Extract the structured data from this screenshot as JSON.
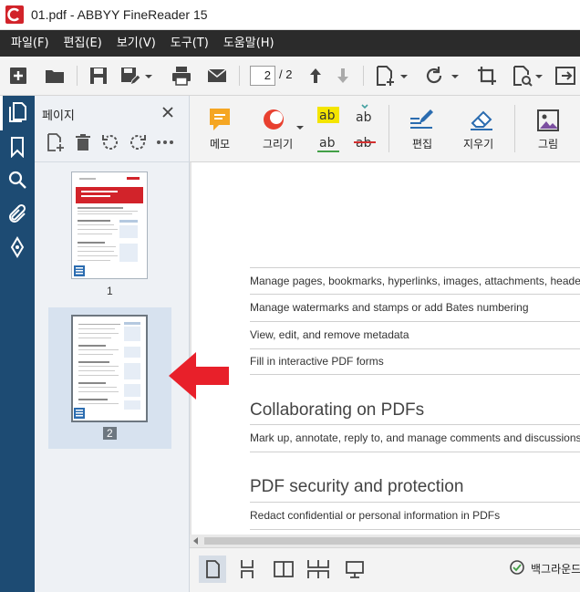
{
  "window": {
    "title": "01.pdf - ABBYY FineReader 15"
  },
  "menu": [
    "파일(F)",
    "편집(E)",
    "보기(V)",
    "도구(T)",
    "도움말(H)"
  ],
  "toolbar": {
    "current_page": "2",
    "page_total": "/ 2",
    "icons": [
      "new-pdf-icon",
      "open-folder-icon",
      "save-icon",
      "save-as-icon",
      "print-icon",
      "email-icon",
      "page-up-icon",
      "page-down-icon",
      "add-page-icon",
      "rotate-icon",
      "crop-icon",
      "search-page-icon",
      "export-icon"
    ]
  },
  "leftnav": {
    "icons": [
      "pages-icon",
      "bookmarks-icon",
      "search-icon",
      "attachments-icon",
      "signatures-icon"
    ]
  },
  "pages_panel": {
    "title": "페이지",
    "tools": [
      "add-page-icon",
      "delete-icon",
      "rotate-left-icon",
      "rotate-right-icon",
      "more-icon"
    ],
    "thumbnails": [
      {
        "number": "1",
        "selected": false
      },
      {
        "number": "2",
        "selected": true
      }
    ]
  },
  "ribbon": {
    "note": "메모",
    "draw": "그리기",
    "edit": "편집",
    "erase": "지우기",
    "image": "그림",
    "text_tools": [
      "highlight-text-icon",
      "insert-text-icon",
      "underline-text-icon",
      "strikethrough-text-icon"
    ],
    "colors": {
      "note": "#f5a623",
      "draw": "#e8402f",
      "highlight": "#f4e500",
      "underline": "#43a047",
      "strike": "#d32f2f",
      "edit": "#2b6cb0"
    }
  },
  "document": {
    "rows": [
      "Manage pages, bookmarks, hyperlinks, images, attachments, headers and footers",
      "Manage watermarks and stamps or add Bates numbering",
      "View, edit, and remove metadata",
      "Fill in interactive PDF forms"
    ],
    "heading_collab": "Collaborating on PDFs",
    "collab_rows": [
      "Mark up, annotate, reply to, and manage comments and discussions in PDFs"
    ],
    "heading_security": "PDF security and protection",
    "security_rows": [
      "Redact confidential or personal information in PDFs"
    ]
  },
  "bottombar": {
    "background_status": "백그라운드",
    "views": [
      "single-page-view-icon",
      "scroll-view-icon",
      "two-page-view-icon",
      "two-page-scroll-view-icon",
      "presentation-view-icon"
    ]
  },
  "annotation": {
    "arrow_color": "#e8202a"
  }
}
